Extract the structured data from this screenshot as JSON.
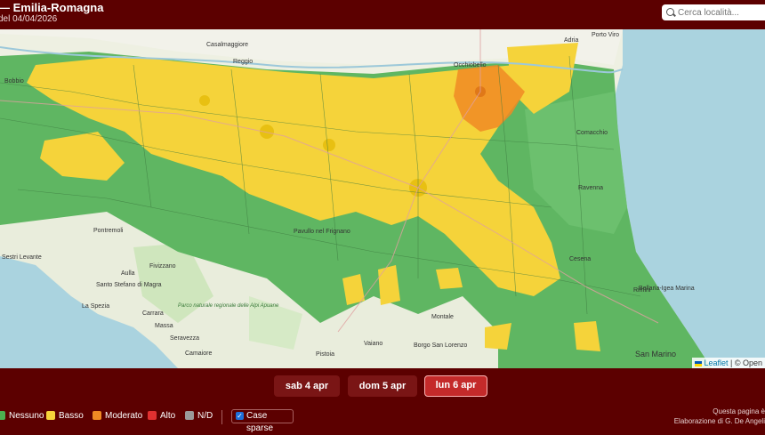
{
  "header": {
    "title": "— Emilia-Romagna",
    "subtitle": "del 04/04/2026",
    "search_placeholder": "Cerca località..."
  },
  "map": {
    "place_labels": [
      "Casalmaggiore",
      "Porto Viro",
      "Adria",
      "Occhiobello",
      "Comacchio",
      "Reggio",
      "Pontremoli",
      "Aulla",
      "Santo Stefano di Magra",
      "La Spezia",
      "Fivizzano",
      "Carrara",
      "Massa",
      "Seravezza",
      "Camaiore",
      "Pistoia",
      "Borgo San Lorenzo",
      "Vaiano",
      "Pavullo nel Frignano",
      "Bobbio",
      "Sestri Levante",
      "Parco naturale regionale delle Alpi Apuane",
      "Montale",
      "San Marino",
      "Rimini",
      "Cesena",
      "Ravenna",
      "Bellaria-Igea Marina"
    ],
    "attribution_link": "Leaflet",
    "attribution_text": "| © Open"
  },
  "dates": [
    {
      "label": "sab 4 apr",
      "active": false
    },
    {
      "label": "dom 5 apr",
      "active": false
    },
    {
      "label": "lun 6 apr",
      "active": true
    }
  ],
  "legend": [
    {
      "label": "Nessuno",
      "color": "#4caf50"
    },
    {
      "label": "Basso",
      "color": "#f5d33a"
    },
    {
      "label": "Moderato",
      "color": "#f08a24"
    },
    {
      "label": "Alto",
      "color": "#e03030"
    },
    {
      "label": "N/D",
      "color": "#9a9a9a"
    }
  ],
  "case_sparse_label": "Case sparse",
  "case_sparse_checked": true,
  "footer": {
    "line1": "Questa pagina è",
    "line2": "Elaborazione di G. De Angeli"
  },
  "colors": {
    "header_bg": "#5c0000",
    "sea": "#aad3df",
    "zone_green": "#4caf50",
    "zone_yellow": "#f5d33a",
    "zone_orange": "#f08a24"
  }
}
